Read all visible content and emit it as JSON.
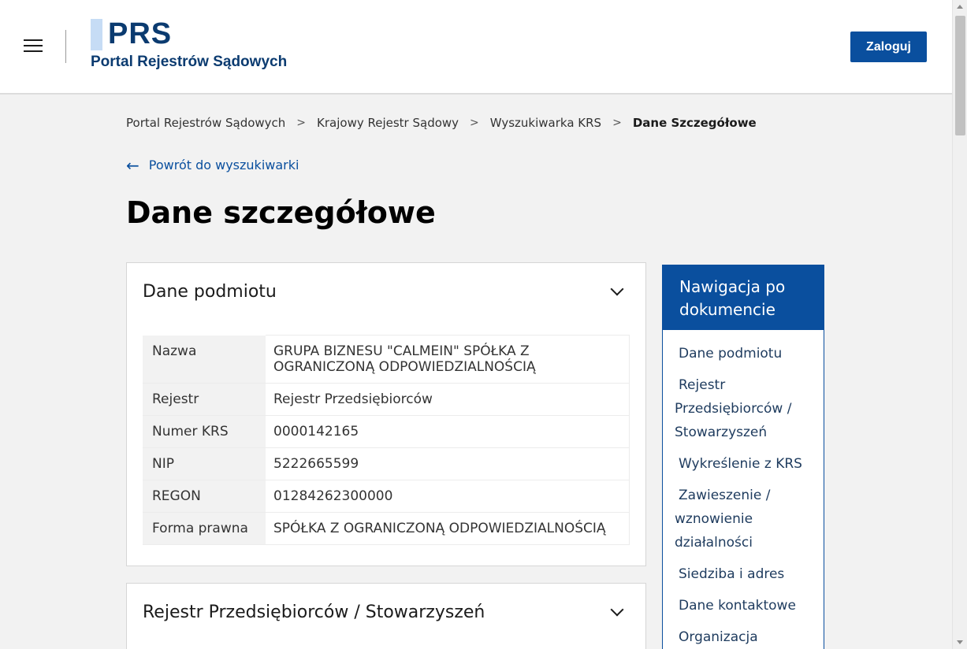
{
  "header": {
    "logo_title": "PRS",
    "logo_subtitle": "Portal Rejestrów Sądowych",
    "login_label": "Zaloguj"
  },
  "breadcrumb": {
    "items": [
      "Portal Rejestrów Sądowych",
      "Krajowy Rejestr Sądowy",
      "Wyszukiwarka KRS"
    ],
    "current": "Dane Szczegółowe",
    "separator": ">"
  },
  "back_link": {
    "arrow": "←",
    "label": "Powrót do wyszukiwarki"
  },
  "page_title": "Dane szczegółowe",
  "sections": {
    "entity": {
      "title": "Dane podmiotu",
      "rows": [
        {
          "label": "Nazwa",
          "value": "GRUPA BIZNESU \"CALMEIN\" SPÓŁKA Z OGRANICZONĄ ODPOWIEDZIALNOŚCIĄ"
        },
        {
          "label": "Rejestr",
          "value": "Rejestr Przedsiębiorców"
        },
        {
          "label": "Numer KRS",
          "value": "0000142165"
        },
        {
          "label": "NIP",
          "value": "5222665599"
        },
        {
          "label": "REGON",
          "value": "01284262300000"
        },
        {
          "label": "Forma prawna",
          "value": "SPÓŁKA Z OGRANICZONĄ ODPOWIEDZIALNOŚCIĄ"
        }
      ]
    },
    "register": {
      "title": "Rejestr Przedsiębiorców / Stowarzyszeń"
    }
  },
  "sidenav": {
    "title": "Nawigacja po dokumencie",
    "items": [
      "Dane podmiotu",
      "Rejestr Przedsiębiorców / Stowarzyszeń",
      "Wykreślenie z KRS",
      "Zawieszenie / wznowienie działalności",
      "Siedziba i adres",
      "Dane kontaktowe",
      "Organizacja Pożytku"
    ]
  },
  "icons": {
    "menu": "hamburger-icon",
    "chevron": "chevron-down-icon",
    "back": "arrow-left-icon"
  },
  "colors": {
    "brand": "#0b3b70",
    "accent": "#0a4f9e",
    "logo_bar": "#c6dcf5",
    "background": "#f2f2f2"
  }
}
